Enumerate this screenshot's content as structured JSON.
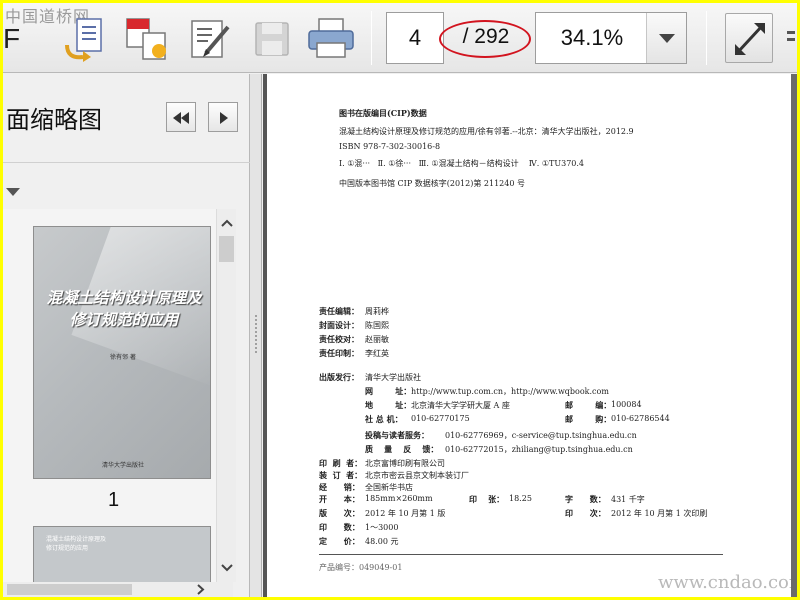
{
  "watermark_top": "中国道桥网",
  "app_title_letter": "F",
  "toolbar": {
    "current_page": "4",
    "total_pages": "/ 292",
    "zoom": "34.1%"
  },
  "left_panel": {
    "title": "面缩略图",
    "thumbnails": [
      {
        "title_lines": [
          "混凝土结构设计原理及",
          "修订规范的应用"
        ],
        "author": "徐有邻 著",
        "publisher": "清华大学出版社",
        "page_number": "1"
      },
      {
        "title_lines": [
          "混凝土结构设计原理及",
          "修订规范的应用"
        ]
      }
    ]
  },
  "document": {
    "cip_header": "图书在版编目(CIP)数据",
    "cip_line1": "混凝土结构设计原理及修订规范的应用/徐有邻著.--北京：清华大学出版社，2012.9",
    "cip_line2": "ISBN 978-7-302-30016-8",
    "cip_line3": "Ⅰ. ①混···   Ⅱ. ①徐···   Ⅲ. ①混凝土结构－结构设计    Ⅳ. ①TU370.4",
    "cip_line4": "中国版本图书馆 CIP 数据核字(2012)第 211240 号",
    "credits": [
      {
        "label": "责任编辑：",
        "value": "周莉桦"
      },
      {
        "label": "封面设计：",
        "value": "陈国熙"
      },
      {
        "label": "责任校对：",
        "value": "赵丽敏"
      },
      {
        "label": "责任印制：",
        "value": "李红英"
      }
    ],
    "publisher_label": "出版发行：",
    "publisher_value": "清华大学出版社",
    "website_label": "网        址：",
    "website_value": "http://www.tup.com.cn，http://www.wqbook.com",
    "address_label": "地        址：",
    "address_value": "北京清华大学学研大厦 A 座",
    "postcode_label": "邮        编：",
    "postcode_value": "100084",
    "switchboard_label": "社 总 机：",
    "switchboard_value": "010-62770175",
    "mailorder_label": "邮        购：",
    "mailorder_value": "010-62786544",
    "submission_label": "投稿与读者服务：",
    "submission_value": "010-62776969，c-service@tup.tsinghua.edu.cn",
    "quality_label": "质    量    反    馈：",
    "quality_value": "010-62772015，zhiliang@tup.tsinghua.edu.cn",
    "printer_label": "印  刷  者：",
    "printer_value": "北京富博印刷有限公司",
    "binder_label": "装  订  者：",
    "binder_value": "北京市密云县京文制本装订厂",
    "dist_label": "经      销：",
    "dist_value": "全国新华书店",
    "format_label": "开      本：",
    "format_value": "185mm×260mm",
    "sheets_label": "印    张：",
    "sheets_value": "18.25",
    "words_label": "字      数：",
    "words_value": "431 千字",
    "edition_label": "版      次：",
    "edition_value": "2012 年 10 月第 1 版",
    "impression_label": "印      次：",
    "impression_value": "2012 年 10 月第 1 次印刷",
    "print_run_label": "印      数：",
    "print_run_value": "1～3000",
    "price_label": "定      价：",
    "price_value": "48.00 元",
    "product_no": "产品编号：049049-01"
  },
  "watermark_bottom": "www.cndao.com"
}
